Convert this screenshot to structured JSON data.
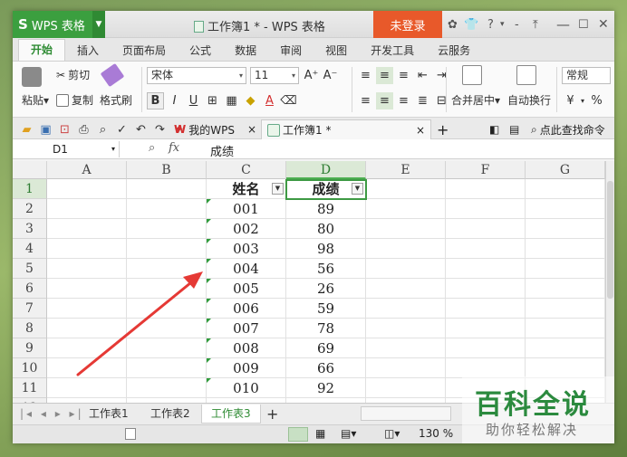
{
  "app": {
    "name": "WPS 表格",
    "logo": "S",
    "window_title": "工作簿1 * - WPS 表格",
    "login_label": "未登录",
    "title_controls": [
      "?",
      "-"
    ]
  },
  "ribbon_tabs": [
    "开始",
    "插入",
    "页面布局",
    "公式",
    "数据",
    "审阅",
    "视图",
    "开发工具",
    "云服务"
  ],
  "ribbon": {
    "paste_label": "粘贴",
    "cut_label": "剪切",
    "copy_label": "复制",
    "format_painter_label": "格式刷",
    "font_name": "宋体",
    "font_size": "11",
    "bold": "B",
    "italic": "I",
    "underline": "U",
    "merge_center_label": "合并居中",
    "wrap_text_label": "自动换行",
    "number_format": "常规",
    "percent": "%"
  },
  "quick_bar": {
    "mywps_tab": "我的WPS",
    "workbook_tab": "工作簿1 *",
    "search_label": "点此查找命令"
  },
  "formula_bar": {
    "name_box": "D1",
    "fx": "fx",
    "value": "成绩"
  },
  "columns": [
    "A",
    "B",
    "C",
    "D",
    "E",
    "F",
    "G"
  ],
  "rows": [
    "1",
    "2",
    "3",
    "4",
    "5",
    "6",
    "7",
    "8",
    "9",
    "10",
    "11",
    "12"
  ],
  "table": {
    "headers": [
      "姓名",
      "成绩"
    ],
    "ids": [
      "001",
      "002",
      "003",
      "004",
      "005",
      "006",
      "007",
      "008",
      "009",
      "010"
    ],
    "scores": [
      "89",
      "80",
      "98",
      "56",
      "26",
      "59",
      "78",
      "69",
      "66",
      "92"
    ]
  },
  "sheet_tabs": [
    "工作表1",
    "工作表2",
    "工作表3"
  ],
  "status": {
    "zoom": "130 %"
  },
  "watermark": {
    "title": "百科全说",
    "subtitle": "助你轻松解决"
  }
}
